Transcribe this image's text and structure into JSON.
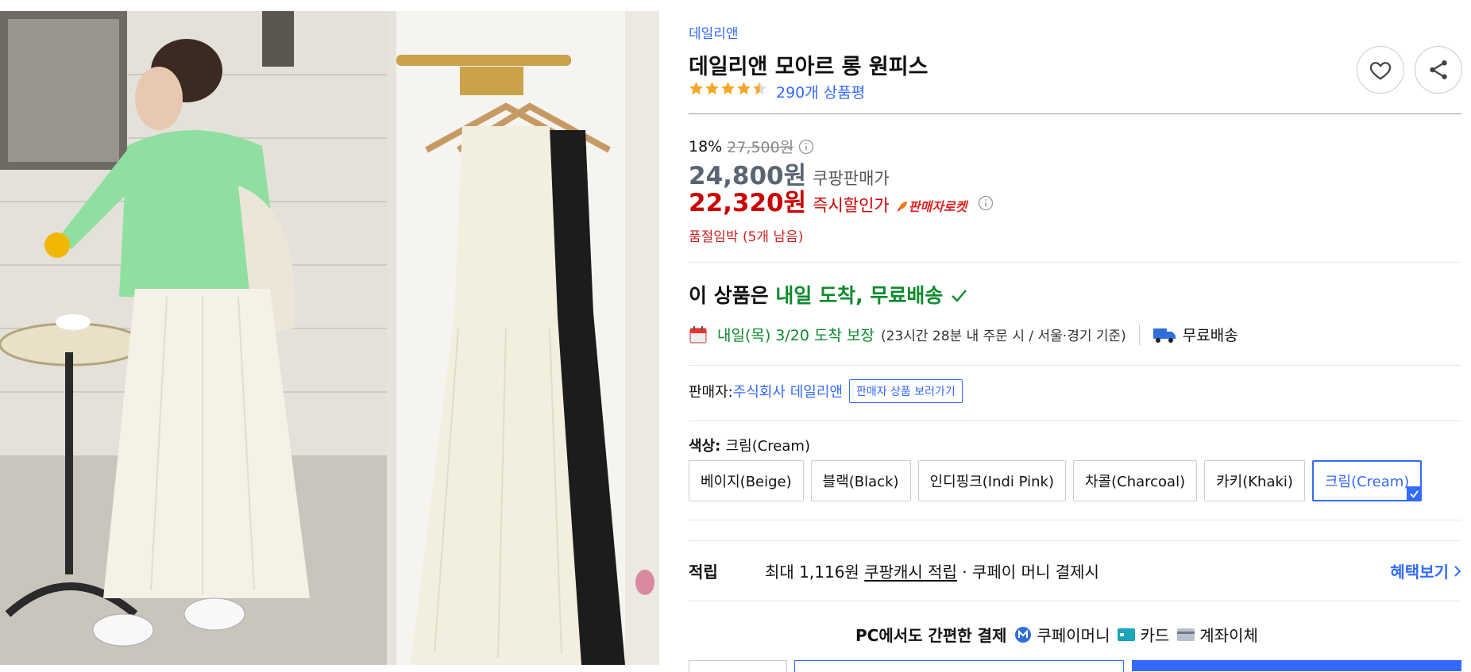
{
  "product": {
    "brand": "데일리앤",
    "title": "데일리앤 모아르 롱 원피스",
    "rating_stars": 4.5,
    "review_count_text": "290개 상품평"
  },
  "pricing": {
    "discount_rate": "18%",
    "original_price": "27,500원",
    "coupang_price": "24,800원",
    "coupang_price_label": "쿠팡판매가",
    "instant_price": "22,320원",
    "instant_price_label": "즉시할인가",
    "rocket_badge": "판매자로켓",
    "stock_notice": "품절임박 (5개 남음)"
  },
  "delivery": {
    "headline_prefix": "이 상품은 ",
    "headline_highlight": "내일 도착, 무료배송",
    "date_text": "내일(목) 3/20 도착 보장",
    "cutoff_text": "(23시간 28분  내 주문 시 / 서울·경기 기준)",
    "shipping_text": "무료배송"
  },
  "seller": {
    "label": "판매자: ",
    "name": "주식회사 데일리앤",
    "button": "판매자 상품 보러가기"
  },
  "color": {
    "label": "색상: ",
    "selected": "크림(Cream)",
    "options": [
      "베이지(Beige)",
      "블랙(Black)",
      "인디핑크(Indi Pink)",
      "차콜(Charcoal)",
      "카키(Khaki)",
      "크림(Cream)"
    ]
  },
  "reward": {
    "label": "적립",
    "text_prefix": "최대 1,116원 ",
    "text_link": "쿠팡캐시 적립",
    "text_suffix": " · 쿠페이 머니 결제시",
    "benefit_link": "혜택보기"
  },
  "payment": {
    "headline": "PC에서도 간편한 결제",
    "methods": [
      "쿠페이머니",
      "카드",
      "계좌이체"
    ]
  },
  "colors": {
    "accent": "#346aff",
    "price_red": "#cc0000",
    "price_gray": "#5a6472",
    "green": "#0f8a2e",
    "star": "#f5a623"
  },
  "icons": {
    "heart": "heart-icon",
    "share": "share-icon",
    "info": "info-icon",
    "calendar": "calendar-icon",
    "truck": "truck-icon",
    "check": "check-icon",
    "rocket": "rocket-icon",
    "chevron": "chevron-right-icon"
  }
}
